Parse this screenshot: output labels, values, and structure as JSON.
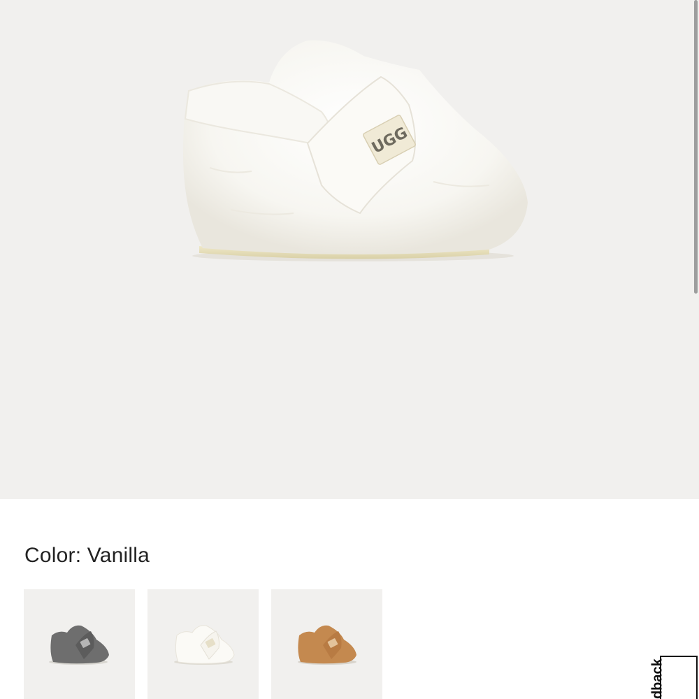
{
  "product_image": {
    "alt": "UGG infant bootie in Vanilla",
    "logo_text": "UGG",
    "background": "#f1f0ee"
  },
  "color_selector": {
    "label": "Color: Vanilla",
    "swatches": [
      {
        "name": "Charcoal",
        "color": "#6b6b6b",
        "selected": false
      },
      {
        "name": "Vanilla",
        "color": "#f4f2ec",
        "selected": true
      },
      {
        "name": "Chestnut",
        "color": "#c08a55",
        "selected": false
      }
    ]
  },
  "feedback_tab": {
    "label": "Feedback"
  }
}
